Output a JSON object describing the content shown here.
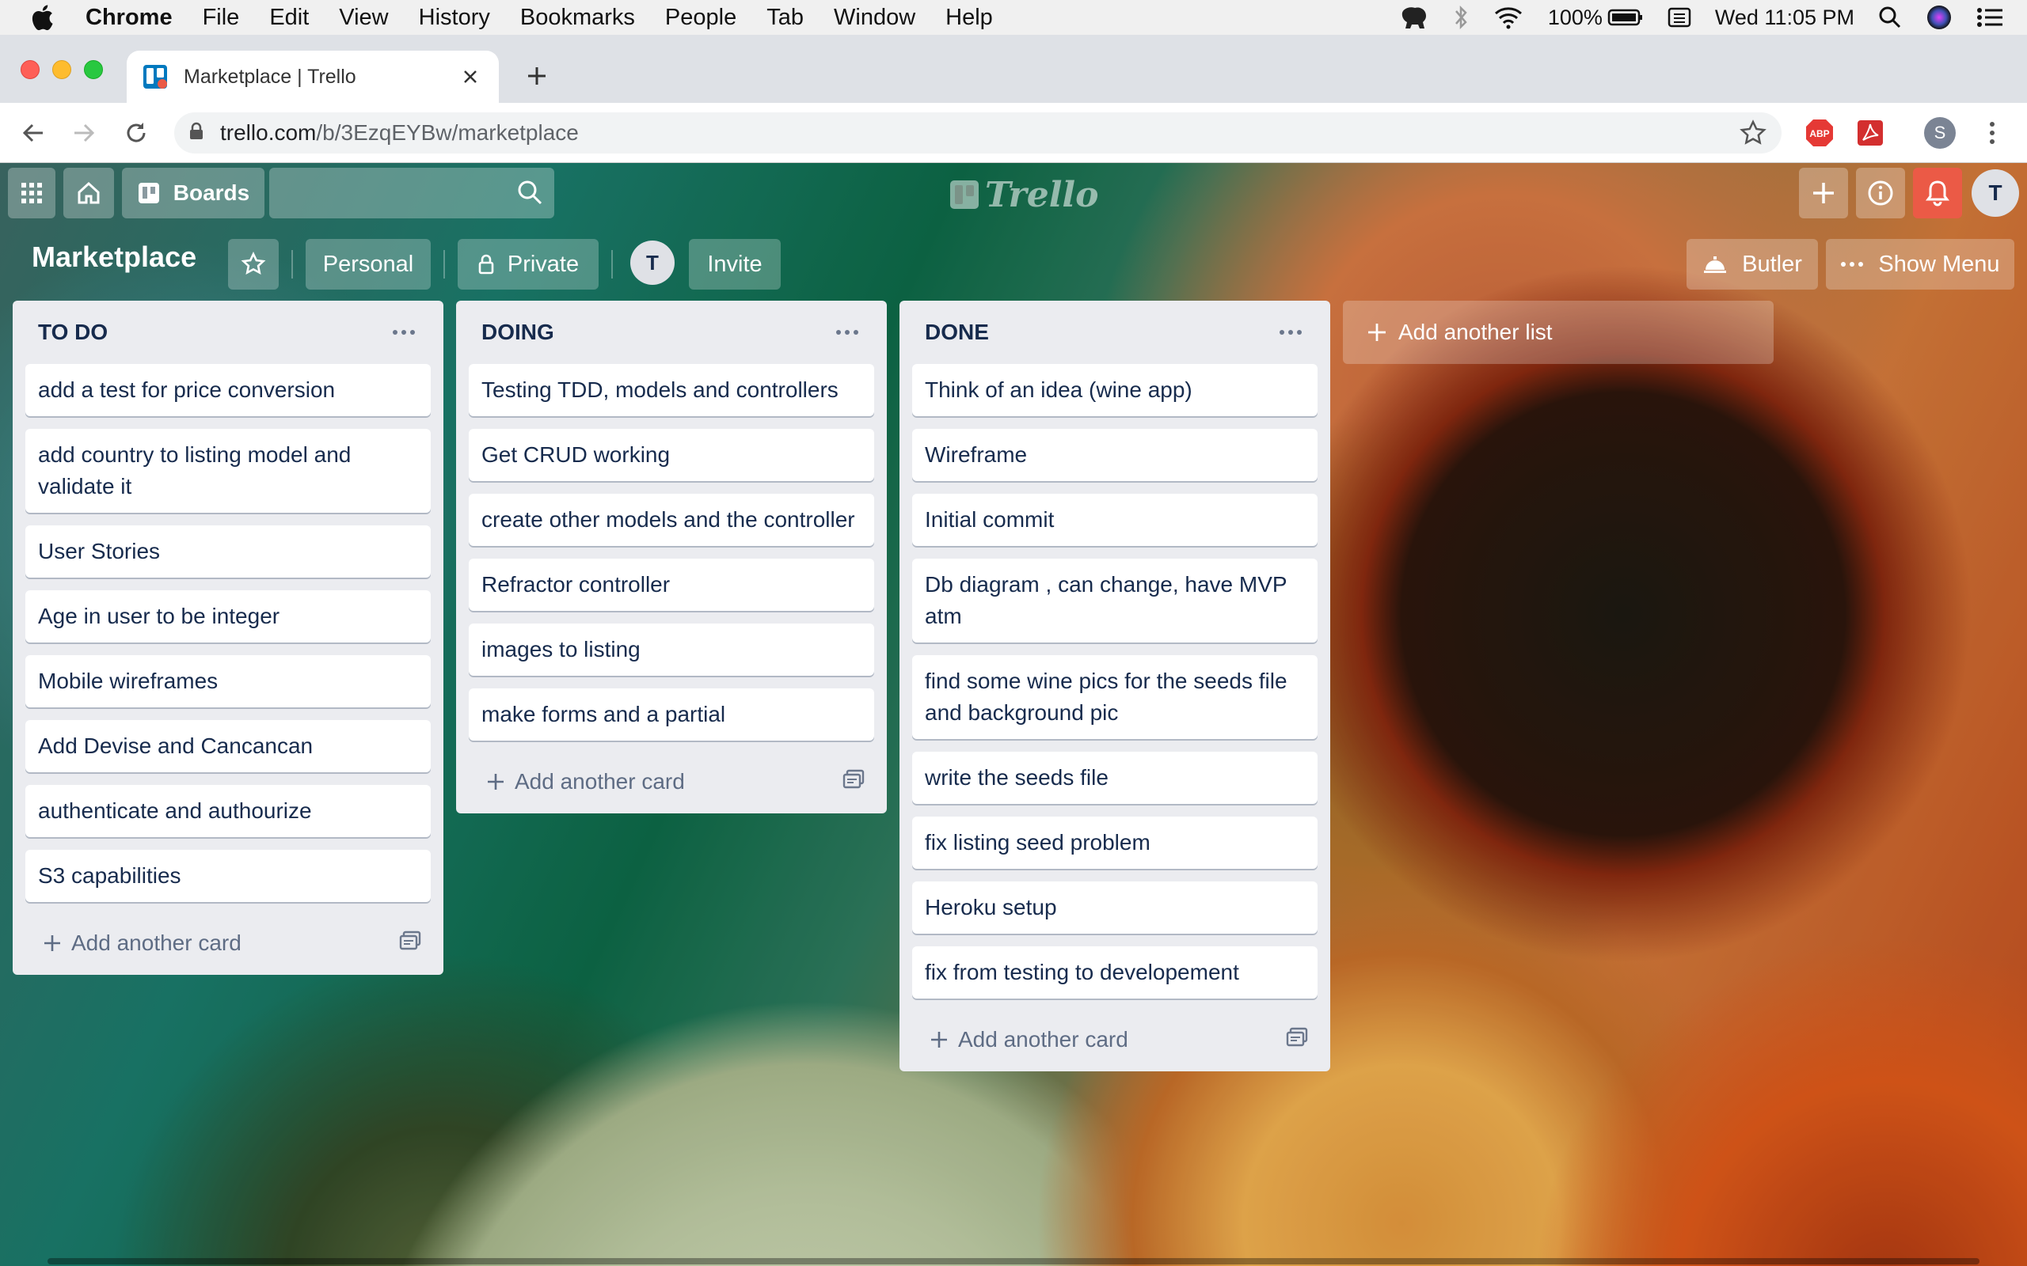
{
  "menubar": {
    "app": "Chrome",
    "items": [
      "File",
      "Edit",
      "View",
      "History",
      "Bookmarks",
      "People",
      "Tab",
      "Window",
      "Help"
    ],
    "battery": "100%",
    "clock": "Wed 11:05 PM"
  },
  "browser": {
    "tab_title": "Marketplace | Trello",
    "url_host": "trello.com",
    "url_path": "/b/3EzqEYBw/marketplace",
    "ext_abp": "ABP",
    "profile_initial": "S"
  },
  "trello": {
    "boards_label": "Boards",
    "logo_text": "Trello",
    "user_initial": "T"
  },
  "board": {
    "title": "Marketplace",
    "team_label": "Personal",
    "visibility_label": "Private",
    "member_initial": "T",
    "invite_label": "Invite",
    "butler_label": "Butler",
    "show_menu_label": "Show Menu"
  },
  "lists": [
    {
      "title": "TO DO",
      "cards": [
        "add a test for price conversion",
        "add country to listing model and validate it",
        "User Stories",
        "Age in user to be integer",
        "Mobile wireframes",
        "Add Devise and Cancancan",
        "authenticate and authourize",
        "S3 capabilities"
      ],
      "add_card_label": "Add another card"
    },
    {
      "title": "DOING",
      "cards": [
        "Testing TDD, models and controllers",
        "Get CRUD working",
        "create other models and the controller",
        "Refractor controller",
        "images to listing",
        "make forms and a partial"
      ],
      "add_card_label": "Add another card"
    },
    {
      "title": "DONE",
      "cards": [
        "Think of an idea (wine app)",
        "Wireframe",
        "Initial commit",
        "Db diagram , can change, have MVP atm",
        "find some wine pics for the seeds file and background pic",
        "write the seeds file",
        "fix listing seed problem",
        "Heroku setup",
        "fix from testing to developement"
      ],
      "add_card_label": "Add another card"
    }
  ],
  "add_list_label": "Add another list"
}
